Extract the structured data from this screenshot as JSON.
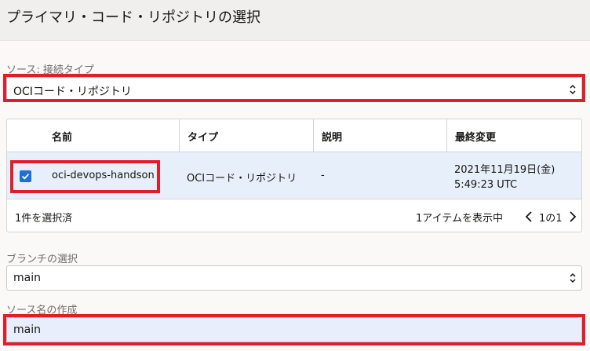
{
  "page": {
    "title": "プライマリ・コード・リポジトリの選択"
  },
  "source_type": {
    "label": "ソース: 接続タイプ",
    "value": "OCIコード・リポジトリ"
  },
  "table": {
    "columns": [
      "名前",
      "タイプ",
      "説明",
      "最終変更"
    ],
    "rows": [
      {
        "selected": true,
        "name": "oci-devops-handson",
        "type": "OCIコード・リポジトリ",
        "description": "-",
        "modified_date": "2021年11月19日(金)",
        "modified_time": "5:49:23 UTC"
      }
    ],
    "selected_count": "1件を選択済",
    "items_shown": "1アイテムを表示中",
    "page_indicator": "1の1"
  },
  "branch": {
    "label": "ブランチの選択",
    "value": "main"
  },
  "source_name": {
    "label": "ソース名の作成",
    "value": "main"
  },
  "colors": {
    "highlight": "#e21d2b",
    "checkbox": "#1d6ed9",
    "selected_row": "#e7f0fa",
    "input_focus": "#e8eefb"
  },
  "icons": {
    "select_chevron": "chevron-up-down-icon",
    "checkbox": "checkmark-icon",
    "prev": "chevron-left-icon",
    "next": "chevron-right-icon"
  }
}
